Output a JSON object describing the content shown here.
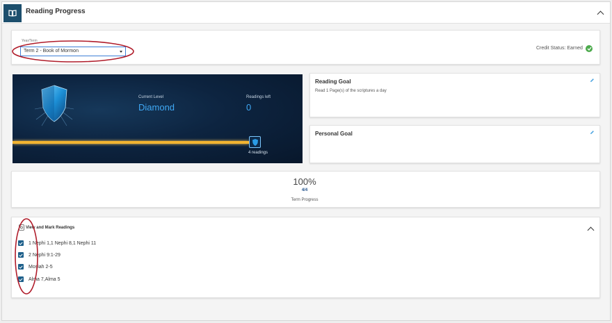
{
  "header": {
    "title": "Reading Progress",
    "book_icon": "book-icon",
    "collapse_icon": "chevron-up-icon"
  },
  "year_term": {
    "label": "Year/Term",
    "selected": "Term 2 - Book of Mormon",
    "credit_status": "Credit Status: Earned",
    "credit_icon": "check-circle-icon"
  },
  "level": {
    "current_level_label": "Current Level",
    "current_level": "Diamond",
    "readings_left_label": "Readings left",
    "readings_left": "0",
    "readings_count": "4 readings",
    "progress": 1.0
  },
  "reading_goal": {
    "title": "Reading Goal",
    "text": "Read 1 Page(s) of the scriptures a day"
  },
  "personal_goal": {
    "title": "Personal Goal"
  },
  "term_progress": {
    "percent": "100%",
    "fraction": "4/4",
    "label": "Term Progress"
  },
  "readings": {
    "title": "View and Mark Readings",
    "items": [
      {
        "label": "1 Nephi 1,1 Nephi 8,1 Nephi 11",
        "checked": true
      },
      {
        "label": "2 Nephi 9:1-29",
        "checked": true
      },
      {
        "label": "Mosiah 2-5",
        "checked": true
      },
      {
        "label": "Alma 7,Alma 5",
        "checked": true
      }
    ]
  },
  "colors": {
    "accent": "#1d4f6d",
    "success": "#4caa4c",
    "annotation": "#b01c2a",
    "progress_bar": "#f2b431"
  }
}
